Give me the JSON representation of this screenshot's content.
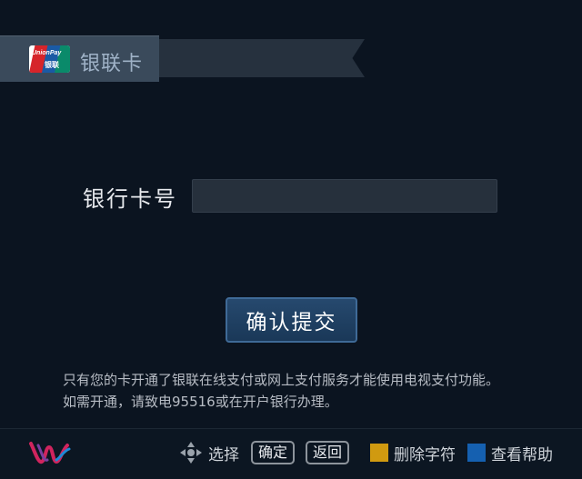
{
  "header": {
    "logo_text": "UnionPay",
    "logo_cn": "银联",
    "title": "银联卡"
  },
  "form": {
    "card_label": "银行卡号",
    "card_value": "",
    "submit_label": "确认提交"
  },
  "notice": {
    "line1": "只有您的卡开通了银联在线支付或网上支付服务才能使用电视支付功能。",
    "line2": "如需开通，请致电95516或在开户银行办理。"
  },
  "footer": {
    "select_label": "选择",
    "ok_key": "确定",
    "back_key": "返回",
    "delete_label": "删除字符",
    "help_label": "查看帮助",
    "colors": {
      "delete": "#d09a10",
      "help": "#1560b0"
    }
  }
}
